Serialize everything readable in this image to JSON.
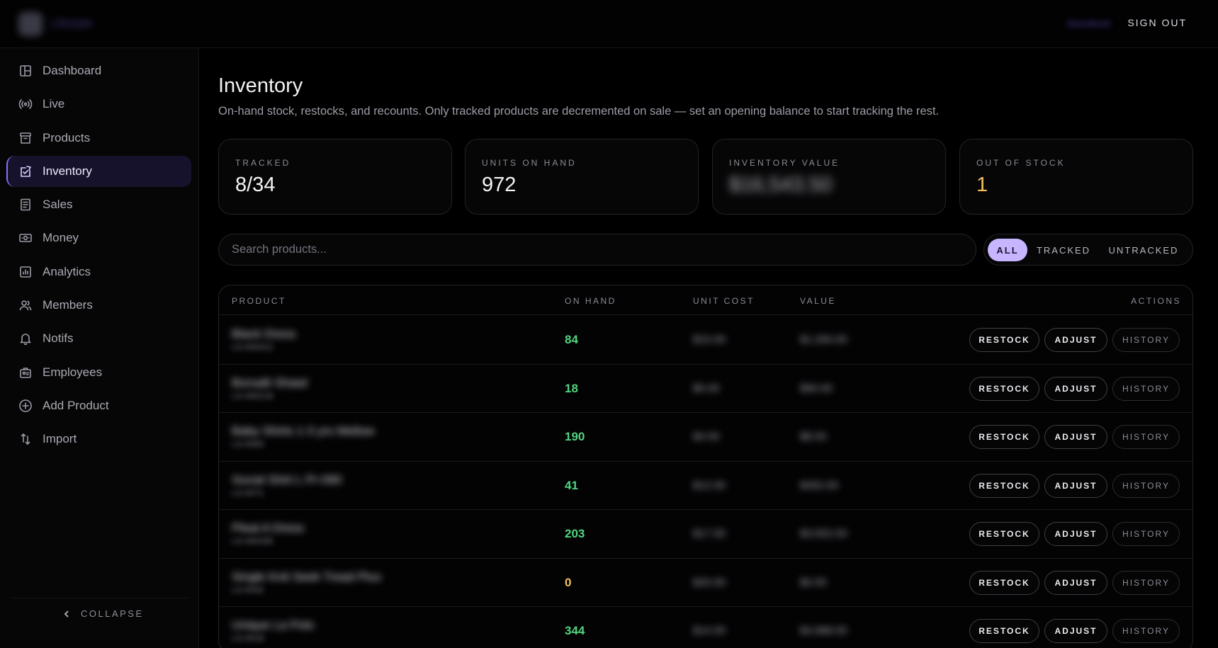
{
  "brand": {
    "name": "Lifestyle"
  },
  "topbar": {
    "link_label": "Storefront",
    "signout_label": "SIGN OUT"
  },
  "sidebar": {
    "items": [
      {
        "label": "Dashboard",
        "icon": "dashboard-icon"
      },
      {
        "label": "Live",
        "icon": "live-icon"
      },
      {
        "label": "Products",
        "icon": "products-icon"
      },
      {
        "label": "Inventory",
        "icon": "inventory-icon",
        "active": true
      },
      {
        "label": "Sales",
        "icon": "sales-icon"
      },
      {
        "label": "Money",
        "icon": "money-icon"
      },
      {
        "label": "Analytics",
        "icon": "analytics-icon"
      },
      {
        "label": "Members",
        "icon": "members-icon"
      },
      {
        "label": "Notifs",
        "icon": "bell-icon"
      },
      {
        "label": "Employees",
        "icon": "employees-icon"
      },
      {
        "label": "Add Product",
        "icon": "add-icon"
      },
      {
        "label": "Import",
        "icon": "import-icon"
      }
    ],
    "collapse_label": "COLLAPSE"
  },
  "page": {
    "title": "Inventory",
    "subtitle": "On-hand stock, restocks, and recounts. Only tracked products are decremented on sale — set an opening balance to start tracking the rest."
  },
  "stats": [
    {
      "label": "TRACKED",
      "value": "8/34"
    },
    {
      "label": "UNITS ON HAND",
      "value": "972"
    },
    {
      "label": "INVENTORY VALUE",
      "value": "$16,543.50"
    },
    {
      "label": "OUT OF STOCK",
      "value": "1"
    }
  ],
  "colors": {
    "accent": "#c7b6ff",
    "in_stock": "#52d57f",
    "warning": "#f3c15c"
  },
  "search": {
    "placeholder": "Search products..."
  },
  "filters": {
    "all": "ALL",
    "tracked": "TRACKED",
    "untracked": "UNTRACKED",
    "selected": "ALL"
  },
  "table": {
    "columns": {
      "product": "PRODUCT",
      "on_hand": "ON HAND",
      "unit_cost": "UNIT COST",
      "value": "VALUE",
      "actions": "ACTIONS"
    },
    "actions": {
      "restock": "RESTOCK",
      "adjust": "ADJUST",
      "history": "HISTORY"
    },
    "rows": [
      {
        "name": "Black Dress",
        "sku": "LS-000412",
        "on_hand": "84",
        "unit_cost": "$15.00",
        "value": "$1,260.00"
      },
      {
        "name": "Borsalli Shawl",
        "sku": "LS-000218",
        "on_hand": "18",
        "unit_cost": "$5.00",
        "value": "$90.00"
      },
      {
        "name": "Baby Shirts 1-3 yrs Mellow",
        "sku": "LS-0093",
        "on_hand": "190",
        "unit_cost": "$4.50",
        "value": "$8.50"
      },
      {
        "name": "Social Shirt L Pr-090",
        "sku": "LS-0071",
        "on_hand": "41",
        "unit_cost": "$12.00",
        "value": "$492.00"
      },
      {
        "name": "Pleat A Dress",
        "sku": "LS-000335",
        "on_hand": "203",
        "unit_cost": "$17.50",
        "value": "$3,552.50"
      },
      {
        "name": "Single Knit Seek Tread Plus",
        "sku": "LS-0042",
        "on_hand": "0",
        "unit_cost": "$20.00",
        "value": "$0.00"
      },
      {
        "name": "Unique La Polo",
        "sku": "LS-0018",
        "on_hand": "344",
        "unit_cost": "$14.00",
        "value": "$4,988.00"
      }
    ]
  }
}
